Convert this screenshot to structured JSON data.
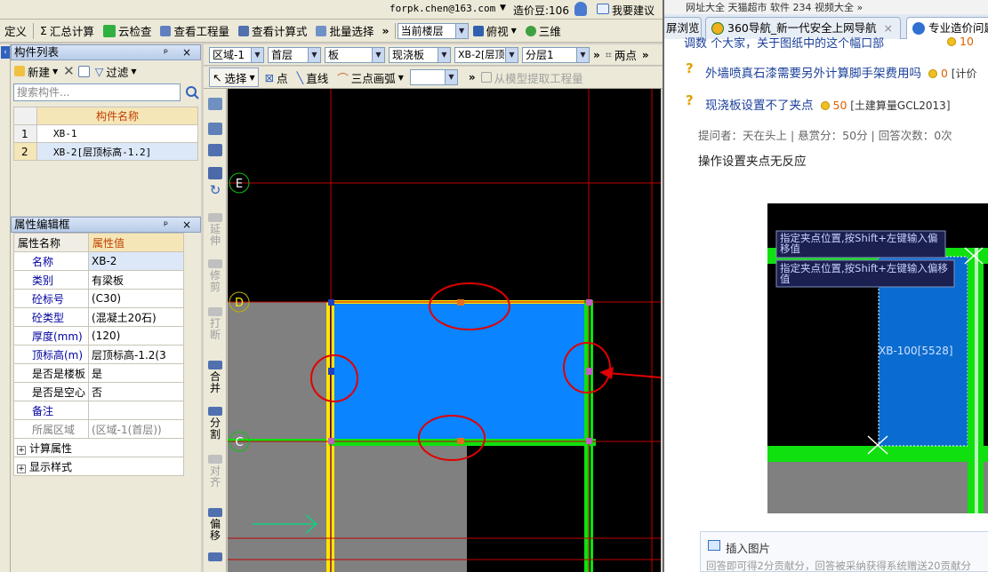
{
  "topbar": {
    "account": "forpk.chen@163.com",
    "bean_label": "造价豆:106",
    "suggestion": "我要建议"
  },
  "toolbar1": {
    "define": "定义",
    "summary_calc": "汇总计算",
    "cloud_check": "云检查",
    "view_quantities": "查看工程量",
    "view_formula": "查看计算式",
    "batch_select": "批量选择",
    "current_floor": "当前楼层",
    "top_view": "俯视",
    "three_d": "三维"
  },
  "toolbar2": {
    "region": "区域-1",
    "floor": "首层",
    "type": "板",
    "subtype": "现浇板",
    "component": "XB-2[层顶",
    "layer": "分层1",
    "two_points": "两点"
  },
  "toolbar3": {
    "select": "选择",
    "point": "点",
    "line": "直线",
    "three_point_arc": "三点画弧",
    "extract": "从模型提取工程量"
  },
  "component_panel": {
    "title": "构件列表",
    "new_label": "新建",
    "filter_label": "过滤",
    "search_placeholder": "搜索构件...",
    "column_header": "构件名称",
    "rows": [
      {
        "index": "1",
        "name": "XB-1"
      },
      {
        "index": "2",
        "name": "XB-2[层顶标高-1.2]"
      }
    ]
  },
  "property_panel": {
    "title": "属性编辑框",
    "col_name": "属性名称",
    "col_value": "属性值",
    "rows": [
      {
        "name": "名称",
        "value": "XB-2"
      },
      {
        "name": "类别",
        "value": "有梁板"
      },
      {
        "name": "砼标号",
        "value": "(C30)"
      },
      {
        "name": "砼类型",
        "value": "(混凝土20石)"
      },
      {
        "name": "厚度(mm)",
        "value": "(120)"
      },
      {
        "name": "顶标高(m)",
        "value": "层顶标高-1.2(3"
      },
      {
        "name": "是否是楼板",
        "value": "是"
      },
      {
        "name": "是否是空心",
        "value": "否"
      },
      {
        "name": "备注",
        "value": ""
      },
      {
        "name": "所属区域",
        "value": "(区域-1(首层))"
      }
    ],
    "expanders": [
      "计算属性",
      "显示样式"
    ]
  },
  "vertical_tools": [
    "延伸",
    "修剪",
    "打断",
    "合并",
    "分割",
    "对齐",
    "偏移"
  ],
  "canvas": {
    "axis_labels": [
      "E",
      "D",
      "C"
    ],
    "colors": {
      "slab": "#0a84ff",
      "beam_green": "#10e010",
      "beam_yellow": "#ffe400",
      "grid_red": "#c00000",
      "annotation": "#e00000"
    }
  },
  "browser": {
    "bookmarks": "网址大全  天猫超市  软件 234  视频大全 »",
    "tabs": [
      "屏浏览",
      "360导航_新一代安全上网导航",
      "专业造价问题"
    ],
    "partial_line": "调数  个大家，关于图纸中的这个幅口部",
    "partial_reward": "10",
    "questions": [
      {
        "title": "外墙喷真石漆需要另外计算脚手架费用吗",
        "reward": "0",
        "category": "[计价"
      },
      {
        "title": "现浇板设置不了夹点",
        "reward": "50",
        "category": "[土建算量GCL2013]"
      }
    ],
    "meta": "提问者：天在头上  |  悬赏分：50分  |  回答次数：0次",
    "body": "操作设置夹点无反应",
    "embedded_image": {
      "tooltip": "指定夹点位置,按Shift+左键输入偏移值",
      "slab_label": "XB-100[5528]"
    },
    "insert_image": "插入图片",
    "insert_hint": "回答即可得2分贡献分，回答被采纳获得系统赠送20贡献分"
  }
}
